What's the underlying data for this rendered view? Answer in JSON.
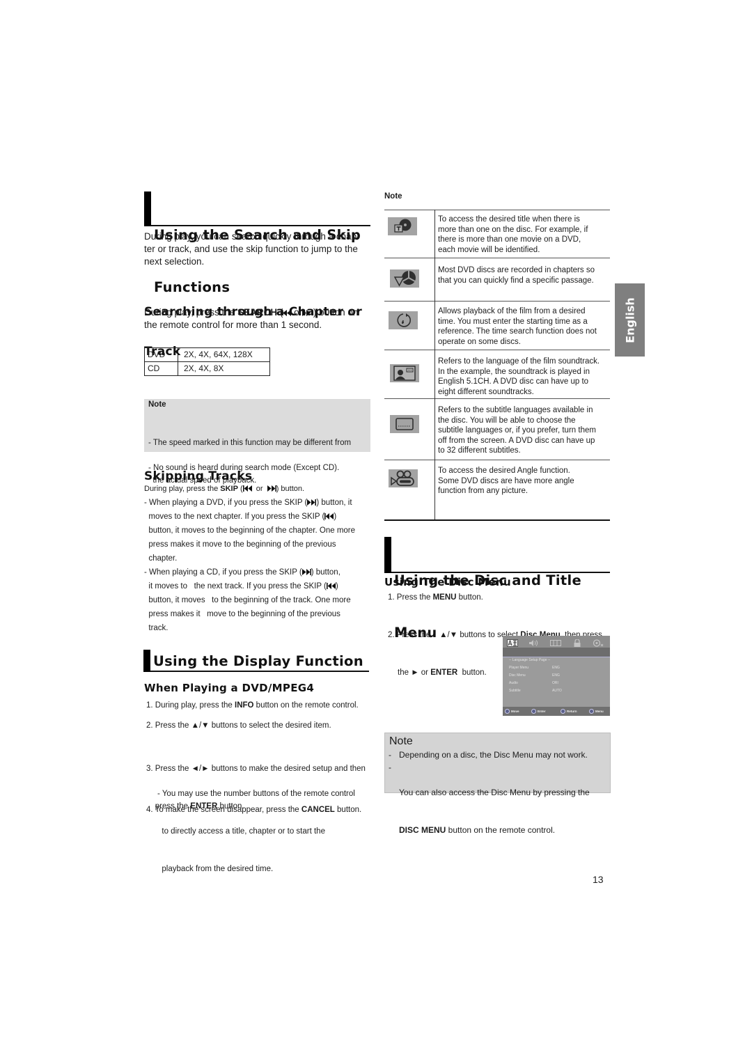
{
  "page": {
    "number": "13",
    "language_tab": "English"
  },
  "colors": {
    "note_bg": "#dcdcdc",
    "note_bg_right": "#d4d4d4",
    "language_tab_bg": "#7f7f7f",
    "icon_bg": "#a3a3a3",
    "heading_bar": "#000000"
  },
  "search_skip": {
    "title_lines": [
      "Using the Search and Skip",
      "Functions"
    ],
    "intro_lines": [
      "During play, you can search quickly through a chap-",
      "ter or track, and use the skip function to jump to the",
      "next selection."
    ],
    "searching": {
      "title_lines": [
        "Searching through a Chapter or",
        "Track"
      ],
      "line1": {
        "pre": "During play, press the ",
        "bold": "SEARCH",
        "open": " (",
        "or": " or",
        "post": " ) button on"
      },
      "line2": "the remote control for more than 1 second."
    },
    "speed_table": {
      "rows": [
        {
          "disc": "DVD",
          "speeds": "2X, 4X, 64X, 128X"
        },
        {
          "disc": "CD",
          "speeds": "2X, 4X, 8X"
        }
      ]
    },
    "note": {
      "title": "Note",
      "items": [
        {
          "lines": [
            "- The speed marked in this function may be different from",
            "  the actual speed of playback."
          ]
        },
        {
          "lines": [
            "- No sound is heard during search mode (Except CD)."
          ]
        }
      ]
    }
  },
  "skipping": {
    "title": "Skipping Tracks",
    "intro": {
      "pre": "During play, press the ",
      "bold": "SKIP",
      "open": " (",
      "or": "  or  ",
      "post": ") button."
    },
    "bullets": [
      {
        "lines": [
          {
            "pre": "- When playing a DVD, if you press the SKIP (",
            "icon": "skip-next-icon",
            "post": ") button, it"
          },
          {
            "pre": "  moves to the next chapter. If you press the SKIP (",
            "icon": "skip-prev-icon",
            "post": ")"
          },
          {
            "text": "  button, it moves to the beginning of the chapter. One more"
          },
          {
            "text": "  press makes it move to the beginning of the previous"
          },
          {
            "text": "  chapter."
          }
        ]
      },
      {
        "lines": [
          {
            "pre": "- When playing a CD, if you press the SKIP (",
            "icon": "skip-next-icon",
            "post": ") button,"
          },
          {
            "pre": "  it moves to   the next track. If you press the SKIP (",
            "icon": "skip-prev-icon",
            "post": ")"
          },
          {
            "text": "  button, it moves   to the beginning of the track. One more"
          },
          {
            "text": "  press makes it   move to the beginning of the previous"
          },
          {
            "text": "  track."
          }
        ]
      }
    ]
  },
  "display": {
    "title": "Using the Display Function",
    "subtitle": "When Playing a DVD/MPEG4",
    "step1": {
      "num": "1. ",
      "pre": "During play, press the ",
      "bold": "INFO",
      "post": " button on the remote control."
    },
    "step2": {
      "num": "2. ",
      "pre": "Press the ",
      "keys": "▲/▼",
      "post": " buttons to select the desired item."
    },
    "step3": {
      "num": "3. ",
      "pre": "Press the ",
      "keys": "◄/►",
      "post": " buttons to make the desired setup and then",
      "line2_pre": "    press the ",
      "line2_bold": "ENTER",
      "line2_post": " button."
    },
    "step3_sub_lines": [
      "- You may use the number buttons of the remote control",
      "  to directly access a title, chapter or to start the",
      "  playback from the desired time."
    ],
    "step4": {
      "num": "4. ",
      "pre": "To make the screen disappear, press the ",
      "bold": "CANCEL",
      "post": " button."
    }
  },
  "info_table": {
    "title": "Note",
    "rows": [
      {
        "icon": "title-icon",
        "lines": [
          "To access the desired title when there is",
          "more than one on the disc. For example, if",
          "there is more than one movie on a DVD,",
          "each movie will be identified."
        ]
      },
      {
        "icon": "chapter-icon",
        "lines": [
          "Most DVD discs are recorded in chapters so",
          "that you can quickly find a specific passage."
        ]
      },
      {
        "icon": "time-icon",
        "lines": [
          "Allows playback of the film from a desired",
          "time. You must enter the starting time as a",
          "reference. The time search function does not",
          "operate on some discs."
        ]
      },
      {
        "icon": "audio-icon",
        "lines": [
          "Refers to the language of the film soundtrack.",
          "In the example, the soundtrack is played in",
          "English 5.1CH. A DVD disc can have up to",
          "eight different soundtracks."
        ]
      },
      {
        "icon": "subtitle-icon",
        "lines": [
          "Refers to the subtitle languages available in",
          "the disc. You will be able to choose the",
          "subtitle languages or, if you prefer, turn them",
          "off from the screen. A DVD disc can have up",
          "to 32 different subtitles."
        ]
      },
      {
        "icon": "angle-icon",
        "lines": [
          "To access the desired Angle function.",
          "Some DVD discs are have more angle",
          "function from any picture."
        ]
      }
    ]
  },
  "disc_menu": {
    "title_lines": [
      "Using the Disc and Title",
      "Menu"
    ],
    "subtitle": "Using The Disc Menu",
    "step1": {
      "num": "1. ",
      "pre": "Press the ",
      "bold": "MENU",
      "post": " button."
    },
    "step2": {
      "num": "2. ",
      "pre": "Press the    ",
      "keys": "▲/▼",
      "mid": " buttons to select ",
      "bold": "Disc Menu",
      "post": ", then press",
      "line2_pre": "the ",
      "line2_key": "►",
      "line2_mid": " or ",
      "line2_bold": "ENTER",
      "line2_post": "  button."
    },
    "screen": {
      "tabs": [
        "language-icon",
        "speaker-icon",
        "display-icon",
        "lock-icon",
        "setup-icon"
      ],
      "header": "-- Language Setup Page --",
      "rows": [
        {
          "label": "Player Menu",
          "value": "ENG"
        },
        {
          "label": "Disc Menu",
          "value": "ENG"
        },
        {
          "label": "Audio",
          "value": "ORI"
        },
        {
          "label": "Subtitle",
          "value": "AUTO"
        }
      ],
      "footer": [
        {
          "icon": "move-icon",
          "label": "Move"
        },
        {
          "icon": "enter-icon",
          "label": "Enter"
        },
        {
          "icon": "return-icon",
          "label": "Return"
        },
        {
          "icon": "menu-icon",
          "label": "Menu"
        }
      ]
    },
    "note": {
      "title": "Note",
      "items": [
        {
          "dash": "-",
          "text": "Depending on a disc, the Disc Menu may not work."
        },
        {
          "dash": "-",
          "text": "You can also access the Disc Menu by pressing the",
          "line2_bold": "DISC MENU",
          "line2_post": " button on the remote control."
        }
      ]
    }
  }
}
